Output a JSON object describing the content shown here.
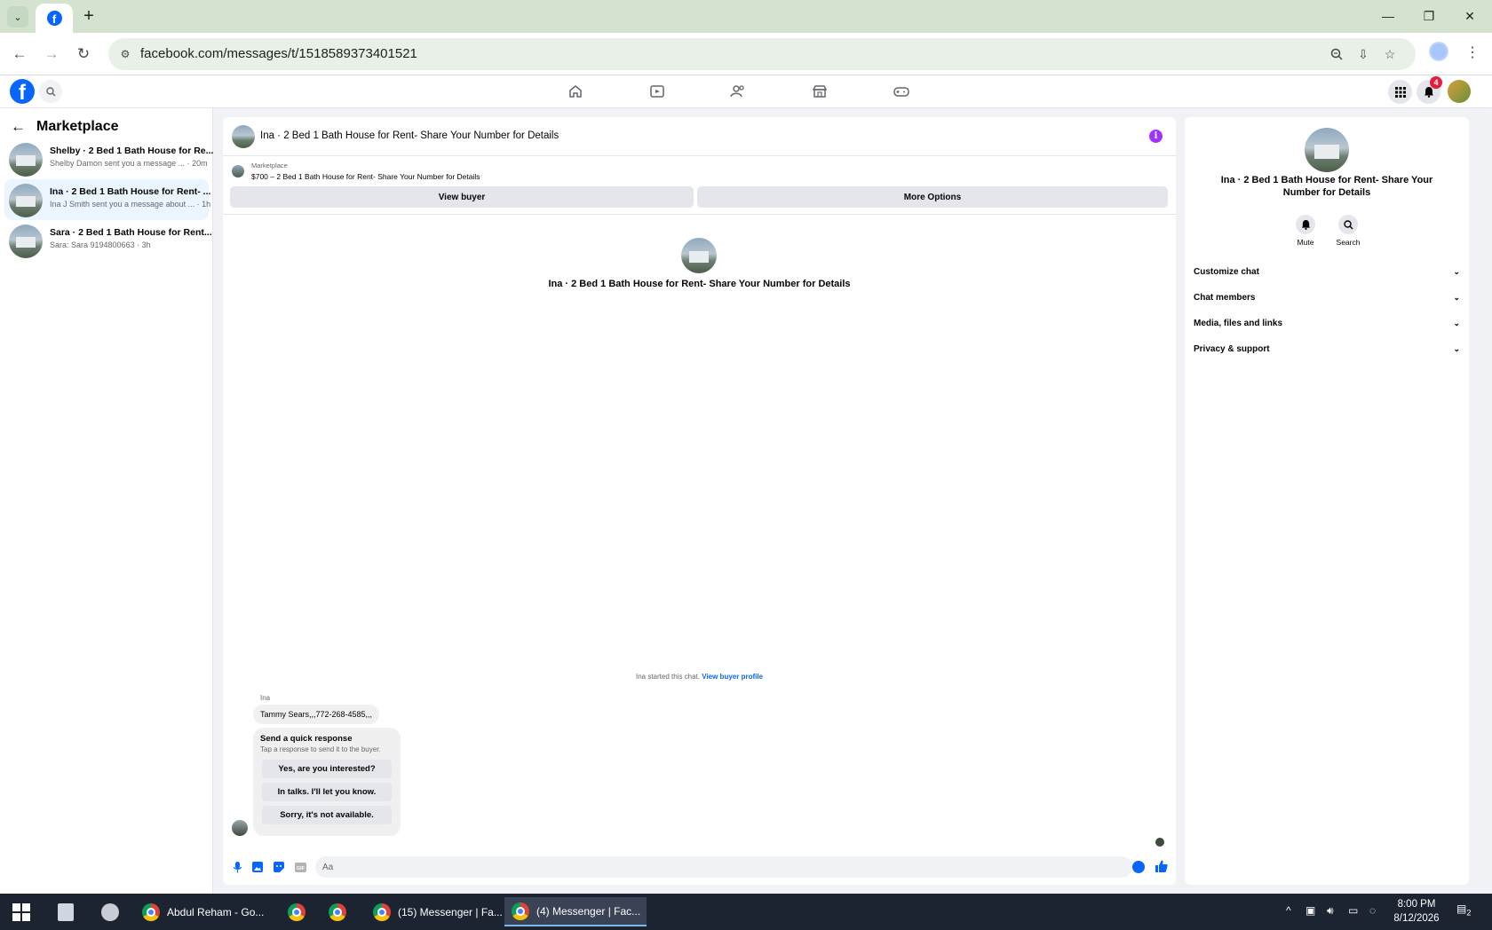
{
  "browser": {
    "url": "facebook.com/messages/t/1518589373401521",
    "tab_new_symbol": "+",
    "tab_menu_symbol": "⌄"
  },
  "fb": {
    "notification_count": "4",
    "nav_icons": [
      "home-icon",
      "video-icon",
      "friends-icon",
      "marketplace-icon",
      "gaming-icon"
    ]
  },
  "sidebar": {
    "title": "Marketplace",
    "conversations": [
      {
        "title": "Shelby · 2 Bed 1 Bath House for Re...",
        "subtitle": "Shelby Damon sent you a message ... · 20m"
      },
      {
        "title": "Ina · 2 Bed 1 Bath House for Rent- ...",
        "subtitle": "Ina J Smith sent you a message about ... · 1h"
      },
      {
        "title": "Sara · 2 Bed 1 Bath House for Rent...",
        "subtitle": "Sara: Sara 9194800663 · 3h"
      }
    ]
  },
  "chat": {
    "header_title": "Ina · 2 Bed 1 Bath House for Rent- Share Your Number for Details",
    "listing_label": "Marketplace",
    "listing_title": "$700 – 2 Bed 1 Bath House for Rent- Share Your Number for Details",
    "view_buyer": "View buyer",
    "more_options": "More Options",
    "center_title": "Ina · 2 Bed 1 Bath House for Rent- Share Your Number for Details",
    "started_text": "Ina started this chat.",
    "view_buyer_profile": "View buyer profile",
    "sender_name": "Ina",
    "message": "Tammy Sears,,,772-268-4585,,,",
    "quick_title": "Send a quick response",
    "quick_sub": "Tap a response to send it to the buyer.",
    "quick_responses": [
      "Yes, are you interested?",
      "In talks. I'll let you know.",
      "Sorry, it's not available."
    ],
    "composer_placeholder": "Aa"
  },
  "details": {
    "title": "Ina · 2 Bed 1 Bath House for Rent- Share Your Number for Details",
    "mute": "Mute",
    "search": "Search",
    "sections": [
      "Customize chat",
      "Chat members",
      "Media, files and links",
      "Privacy & support"
    ]
  },
  "taskbar": {
    "apps": [
      {
        "label": "Abdul Reham - Go..."
      },
      {
        "label": ""
      },
      {
        "label": ""
      },
      {
        "label": "(15) Messenger | Fa..."
      },
      {
        "label": "(4) Messenger | Fac..."
      }
    ],
    "time": "8:00 PM",
    "date": "8/12/2026",
    "notif_count": "2"
  },
  "colors": {
    "accent": "#0866ff",
    "tabbar": "#d3e3d0",
    "info": "#a033ff",
    "badge": "#e41e3f"
  }
}
